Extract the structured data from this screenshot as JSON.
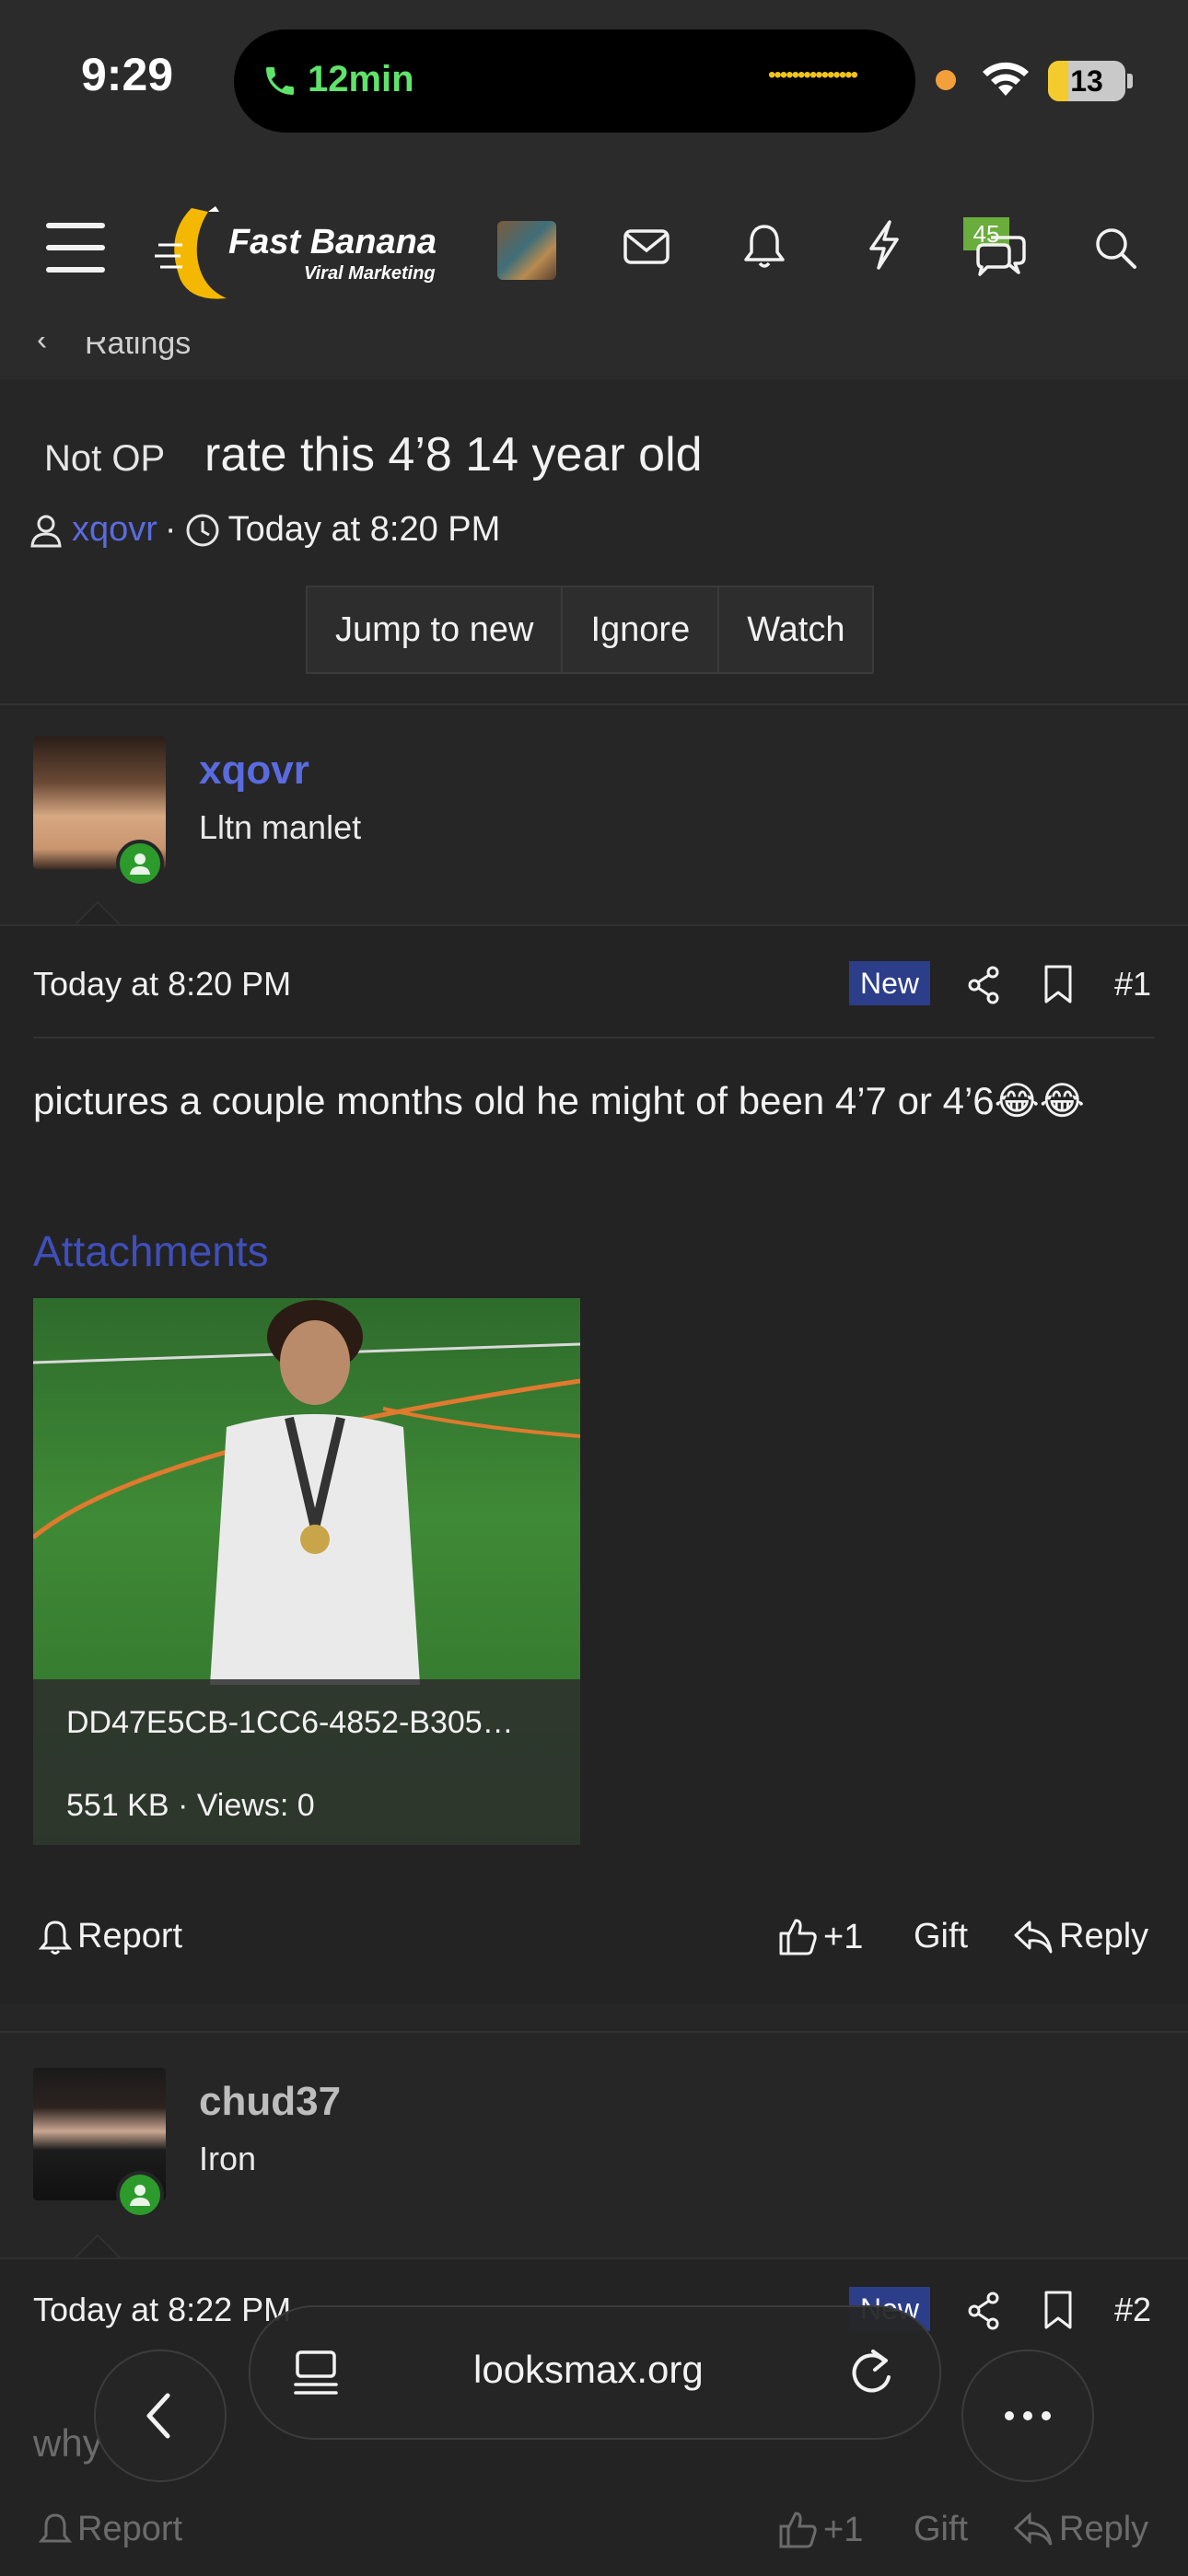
{
  "status_bar": {
    "time": "9:29",
    "call_duration": "12min",
    "battery": "13"
  },
  "header": {
    "logo_title": "Fast Banana",
    "logo_subtitle": "Viral Marketing",
    "conversations_badge": "45",
    "icons": [
      "menu-icon",
      "mail-icon",
      "bell-icon",
      "lightning-icon",
      "chat-icon",
      "search-icon"
    ]
  },
  "breadcrumb": "Ratings",
  "thread": {
    "prefix": "Not OP",
    "title": "rate this 4’8 14 year old",
    "author": "xqovr",
    "time": "Today at 8:20 PM",
    "buttons": [
      "Jump to new",
      "Ignore",
      "Watch"
    ]
  },
  "posts": [
    {
      "username": "xqovr",
      "user_title": "Lltn manlet",
      "username_color": "#5a6be0",
      "time": "Today at 8:20 PM",
      "badge": "New",
      "number": "#1",
      "body": "pictures a couple months old he might of been 4’7 or 4’6😂😂",
      "attachments_label": "Attachments",
      "attachment": {
        "name": "DD47E5CB-1CC6-4852-B305…",
        "info": "551 KB · Views: 0"
      },
      "actions": {
        "report": "Report",
        "like": "+1",
        "gift": "Gift",
        "reply": "Reply"
      }
    },
    {
      "username": "chud37",
      "user_title": "Iron",
      "username_color": "#bdbdbd",
      "time": "Today at 8:22 PM",
      "badge": "New",
      "number": "#2",
      "body": "why",
      "actions": {
        "report": "Report",
        "like": "+1",
        "gift": "Gift",
        "reply": "Reply"
      }
    }
  ],
  "browser": {
    "url": "looksmax.org"
  },
  "colors": {
    "accent": "#5a6be0",
    "new_badge": "#2c3d8a",
    "online": "#2c9b2c",
    "badge_green": "#6aad3c"
  }
}
